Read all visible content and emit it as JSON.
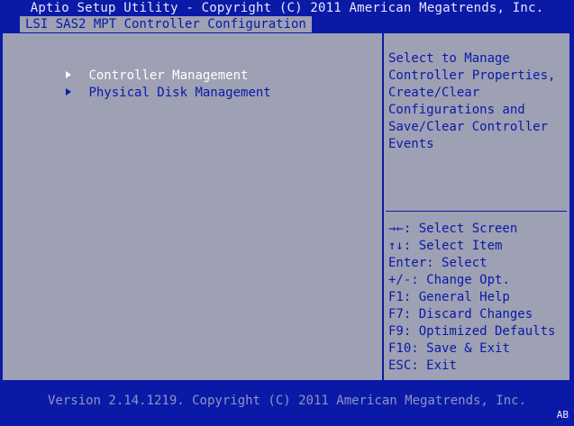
{
  "header": {
    "title": "Aptio Setup Utility - Copyright (C) 2011 American Megatrends, Inc."
  },
  "tab": {
    "label": "LSI SAS2 MPT Controller Configuration"
  },
  "menu": {
    "items": [
      {
        "label": "Controller Management",
        "selected": true
      },
      {
        "label": "Physical Disk Management",
        "selected": false
      }
    ]
  },
  "help": {
    "description": "Select to Manage\nController Properties,\nCreate/Clear\nConfigurations and\nSave/Clear Controller\nEvents",
    "keys": [
      {
        "key": "→←",
        "action": ": Select Screen"
      },
      {
        "key": "↑↓",
        "action": ": Select Item"
      },
      {
        "key": "Enter",
        "action": ": Select"
      },
      {
        "key": "+/-",
        "action": ": Change Opt."
      },
      {
        "key": "F1",
        "action": ": General Help"
      },
      {
        "key": "F7",
        "action": ": Discard Changes"
      },
      {
        "key": "F9",
        "action": ": Optimized Defaults"
      },
      {
        "key": "F10",
        "action": ": Save & Exit"
      },
      {
        "key": "ESC",
        "action": ": Exit"
      }
    ]
  },
  "footer": {
    "version": "Version 2.14.1219. Copyright (C) 2011 American Megatrends, Inc."
  },
  "corner_badge": "AB",
  "colors": {
    "background": "#0a1aa6",
    "panel": "#9ea0b4",
    "text": "#0a1aa6",
    "selected_text": "#ffffff"
  }
}
